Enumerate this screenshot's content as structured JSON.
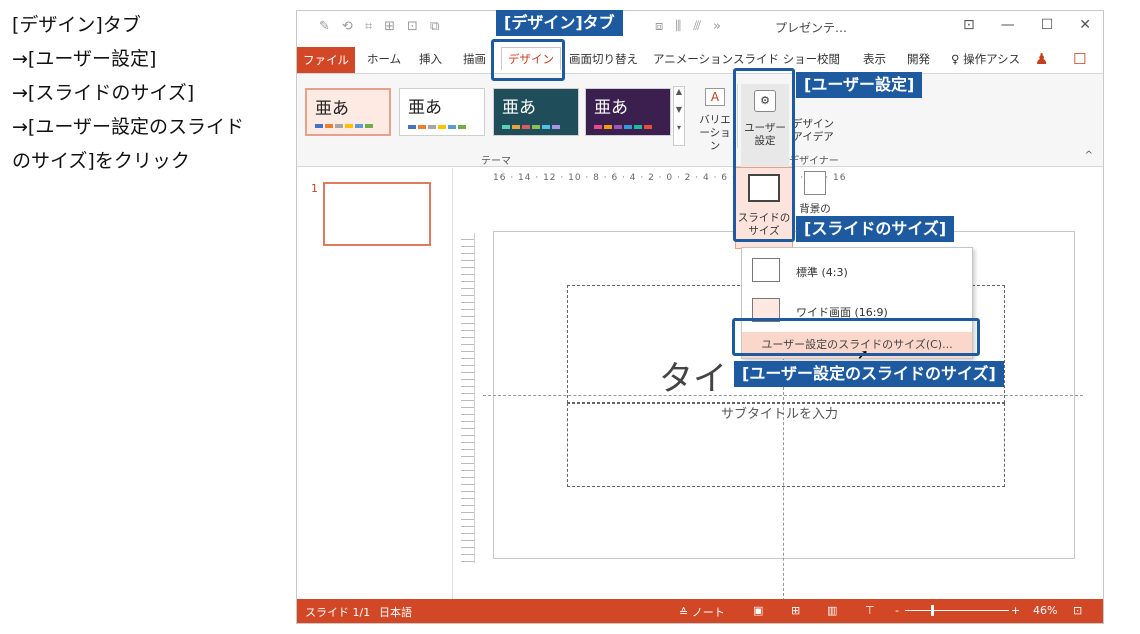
{
  "instructions": [
    "[デザイン]タブ",
    "→[ユーザー設定]",
    "→[スライドのサイズ]",
    "→[ユーザー設定のスライド",
    "のサイズ]をクリック"
  ],
  "window": {
    "title": "プレゼンテ…",
    "more_glyph": "»"
  },
  "tabs": {
    "file": "ファイル",
    "home": "ホーム",
    "insert": "挿入",
    "draw": "描画",
    "design": "デザイン",
    "transitions": "画面切り替え",
    "animations": "アニメーション",
    "slideshow": "スライド ショー",
    "review": "校閲",
    "view": "表示",
    "developer": "開発",
    "tellme": "操作アシス"
  },
  "ribbon": {
    "theme_sample": "亜あ",
    "theme_group_label": "テーマ",
    "variation": "バリエーション",
    "user_setting": "ユーザー設定",
    "design_idea": "デザインアイデア",
    "designer_label": "デザイナー",
    "slide_size": "スライドのサイズ",
    "bg_format": "背景の書",
    "collapse": "^"
  },
  "dropdown": {
    "standard": "標準 (4:3)",
    "wide": "ワイド画面 (16:9)",
    "custom": "ユーザー設定のスライドのサイズ(C)..."
  },
  "slide": {
    "title_placeholder": "タイ",
    "subtitle_placeholder": "サブタイトルを入力",
    "thumb_number": "1",
    "ruler_h": "16 · 14 · 12 · 10 · 8 · 6 · 4 · 2 · 0 · 2 · 4 · 6 · 8 · 10 · 12 · 14 · 16"
  },
  "status": {
    "slide_count": "スライド 1/1",
    "language": "日本語",
    "notes": "≙ ノート",
    "zoom_minus": "-",
    "zoom_plus": "+",
    "zoom_pct": "46%"
  },
  "callouts": {
    "design_tab": "[デザイン]タブ",
    "user_setting": "[ユーザー設定]",
    "slide_size": "[スライドのサイズ]",
    "custom_size": "[ユーザー設定のスライドのサイズ]"
  },
  "colors": {
    "accent": "#d24726",
    "callout": "#1e5aa0"
  }
}
